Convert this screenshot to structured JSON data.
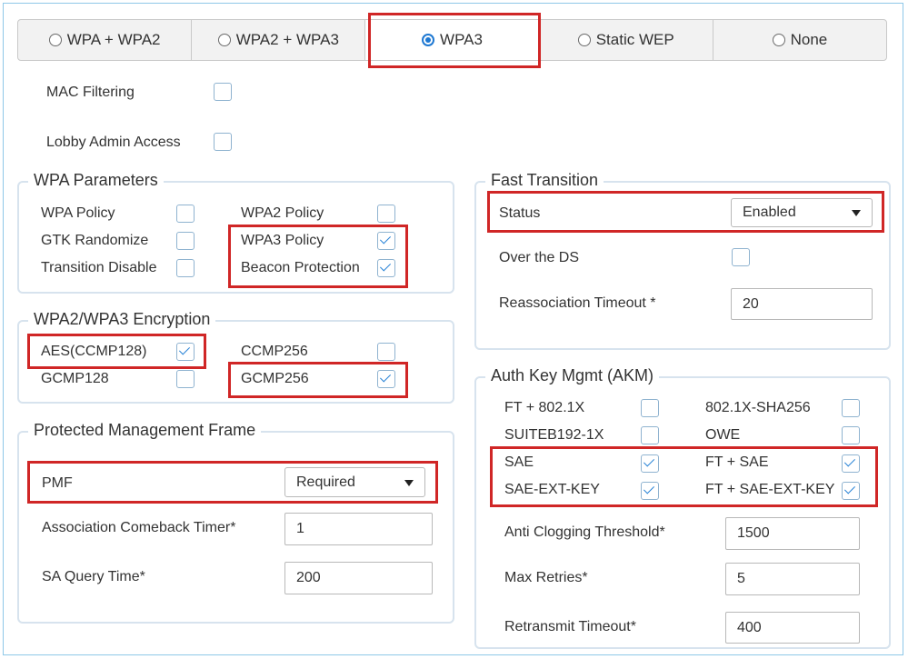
{
  "security_modes": [
    {
      "label": "WPA + WPA2",
      "selected": false
    },
    {
      "label": "WPA2 + WPA3",
      "selected": false
    },
    {
      "label": "WPA3",
      "selected": true
    },
    {
      "label": "Static WEP",
      "selected": false
    },
    {
      "label": "None",
      "selected": false
    }
  ],
  "mac_filtering": {
    "label": "MAC Filtering",
    "checked": false
  },
  "lobby_admin": {
    "label": "Lobby Admin Access",
    "checked": false
  },
  "wpa_params": {
    "title": "WPA Parameters",
    "wpa_policy": {
      "label": "WPA Policy",
      "checked": false
    },
    "gtk_randomize": {
      "label": "GTK Randomize",
      "checked": false
    },
    "transition_disable": {
      "label": "Transition Disable",
      "checked": false
    },
    "wpa2_policy": {
      "label": "WPA2 Policy",
      "checked": false
    },
    "wpa3_policy": {
      "label": "WPA3 Policy",
      "checked": true
    },
    "beacon_protection": {
      "label": "Beacon Protection",
      "checked": true
    }
  },
  "encryption": {
    "title": "WPA2/WPA3 Encryption",
    "aes": {
      "label": "AES(CCMP128)",
      "checked": true
    },
    "gcmp128": {
      "label": "GCMP128",
      "checked": false
    },
    "ccmp256": {
      "label": "CCMP256",
      "checked": false
    },
    "gcmp256": {
      "label": "GCMP256",
      "checked": true
    }
  },
  "pmf": {
    "title": "Protected Management Frame",
    "pmf_label": "PMF",
    "pmf_value": "Required",
    "comeback_label": "Association Comeback Timer*",
    "comeback_value": "1",
    "sa_query_label": "SA Query Time*",
    "sa_query_value": "200"
  },
  "fast_transition": {
    "title": "Fast Transition",
    "status_label": "Status",
    "status_value": "Enabled",
    "over_ds_label": "Over the DS",
    "over_ds_checked": false,
    "reassoc_label": "Reassociation Timeout *",
    "reassoc_value": "20"
  },
  "akm": {
    "title": "Auth Key Mgmt (AKM)",
    "ft_8021x": {
      "label": "FT + 802.1X",
      "checked": false
    },
    "suiteb192": {
      "label": "SUITEB192-1X",
      "checked": false
    },
    "sae": {
      "label": "SAE",
      "checked": true
    },
    "sae_ext": {
      "label": "SAE-EXT-KEY",
      "checked": true
    },
    "sha256": {
      "label": "802.1X-SHA256",
      "checked": false
    },
    "owe": {
      "label": "OWE",
      "checked": false
    },
    "ft_sae": {
      "label": "FT + SAE",
      "checked": true
    },
    "ft_sae_ext": {
      "label": "FT + SAE-EXT-KEY",
      "checked": true
    },
    "anti_clog_label": "Anti Clogging Threshold*",
    "anti_clog_value": "1500",
    "max_retries_label": "Max Retries*",
    "max_retries_value": "5",
    "retransmit_label": "Retransmit Timeout*",
    "retransmit_value": "400"
  },
  "colors": {
    "highlight": "#d02626",
    "accent": "#1e78d2",
    "group_border": "#d7e3ee"
  }
}
